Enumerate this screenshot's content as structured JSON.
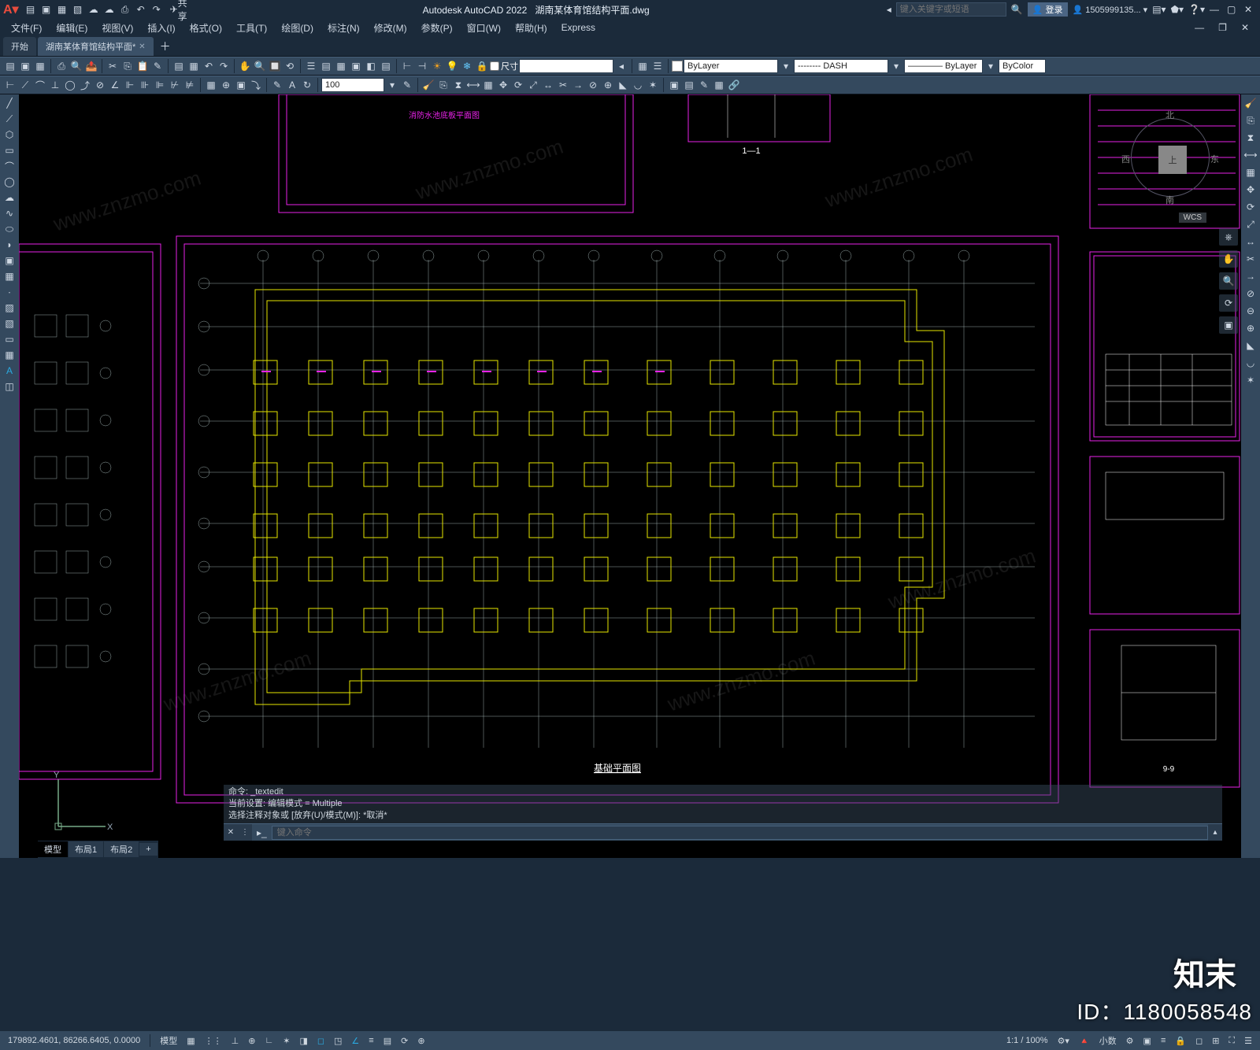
{
  "app": {
    "title_prefix": "Autodesk AutoCAD 2022",
    "drawing_name": "湖南某体育馆结构平面.dwg",
    "share": "共享",
    "search_placeholder": "键入关键字或短语",
    "login_label": "登录",
    "user": "1505999135..."
  },
  "menus": [
    "文件(F)",
    "编辑(E)",
    "视图(V)",
    "插入(I)",
    "格式(O)",
    "工具(T)",
    "绘图(D)",
    "标注(N)",
    "修改(M)",
    "参数(P)",
    "窗口(W)",
    "帮助(H)",
    "Express"
  ],
  "tabs": {
    "start": "开始",
    "file": "湖南某体育馆结构平面*"
  },
  "toolbar": {
    "scale_value": "100",
    "dim_checkbox": "尺寸",
    "layer": "ByLayer",
    "linetype": "-------- DASH",
    "lineweight": "———— ByLayer",
    "color": "ByColor"
  },
  "viewcube": {
    "top": "北",
    "right": "东",
    "bottom": "南",
    "left": "西",
    "face": "上",
    "wcs": "WCS"
  },
  "cmd": {
    "h1": "命令: _textedit",
    "h2": "当前设置: 编辑模式 = Multiple",
    "h3": "选择注释对象或 [放弃(U)/模式(M)]: *取消*",
    "placeholder": "键入命令",
    "prompt": "▸_"
  },
  "layout_tabs": {
    "lbl1": "模型",
    "lbl2": "布局1",
    "lbl3": "布局2",
    "plus": "+"
  },
  "status": {
    "coords": "179892.4601, 86266.6405, 0.0000",
    "model": "模型",
    "scale": "1:1 / 100%",
    "decimal": "小数"
  },
  "drawing_labels": {
    "section": "1—1",
    "pool_title": "消防水池底板平面图",
    "plan_title": "基础平面图",
    "detail": "9-9"
  },
  "watermark": "www.znzmo.com",
  "brand": "知末",
  "id_stamp": "ID：1180058548"
}
